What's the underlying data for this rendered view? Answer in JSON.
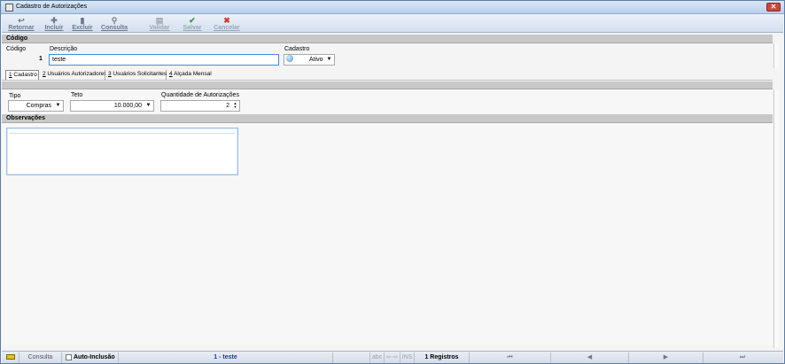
{
  "window": {
    "title": "Cadastro de Autorizações",
    "close_glyph": "✕"
  },
  "toolbar": {
    "retornar": {
      "label": "Retornar",
      "icon": "return-arrow-icon",
      "glyph": "↩"
    },
    "incluir": {
      "label": "Incluir",
      "icon": "plus-icon",
      "glyph": "✚"
    },
    "excluir": {
      "label": "Excluir",
      "icon": "trash-icon",
      "glyph": "▮"
    },
    "consulta": {
      "label": "Consulta",
      "icon": "search-icon",
      "glyph": "⚲"
    },
    "validar": {
      "label": "Validar",
      "icon": "document-icon",
      "glyph": "▤"
    },
    "salvar": {
      "label": "Salvar",
      "icon": "check-icon",
      "glyph": "✔"
    },
    "cancelar": {
      "label": "Cancelar",
      "icon": "x-icon",
      "glyph": "✖"
    },
    "accent_check": "#2e9e3a",
    "accent_cancel": "#d33a2c"
  },
  "header": {
    "section_title": "Código",
    "codigo_label": "Código",
    "codigo_value": "1",
    "descricao_label": "Descrição",
    "descricao_value": "teste",
    "cadastro_label": "Cadastro",
    "cadastro_value": "Ativo",
    "cadastro_arrow": "▼"
  },
  "tabs": [
    {
      "key": "1",
      "label": " Cadastro"
    },
    {
      "key": "2",
      "label": " Usuários Autorizadores"
    },
    {
      "key": "3",
      "label": " Usuários Solicitantes"
    },
    {
      "key": "4",
      "label": " Alçada Mensal"
    }
  ],
  "form": {
    "tipo_label": "Tipo",
    "tipo_value": "Compras",
    "teto_label": "Teto",
    "teto_value": "10.000,00",
    "qtd_label": "Quantidade de Autorizações",
    "qtd_value": "2",
    "arrow": "▼",
    "spin_up": "▲",
    "spin_down": "▼"
  },
  "observacoes": {
    "title": "Observações",
    "value": ""
  },
  "status": {
    "mode": "Consulta",
    "auto_inclusao": "Auto-Inclusão",
    "current_record": "1 - teste",
    "abc": "abc",
    "arrows": "⇦ ⇨",
    "ins": "INS",
    "registros": "1 Registros",
    "nav_first": "⏮",
    "nav_prev": "◀",
    "nav_next": "▶",
    "nav_last": "⏭",
    "icon": "keyboard-icon"
  }
}
